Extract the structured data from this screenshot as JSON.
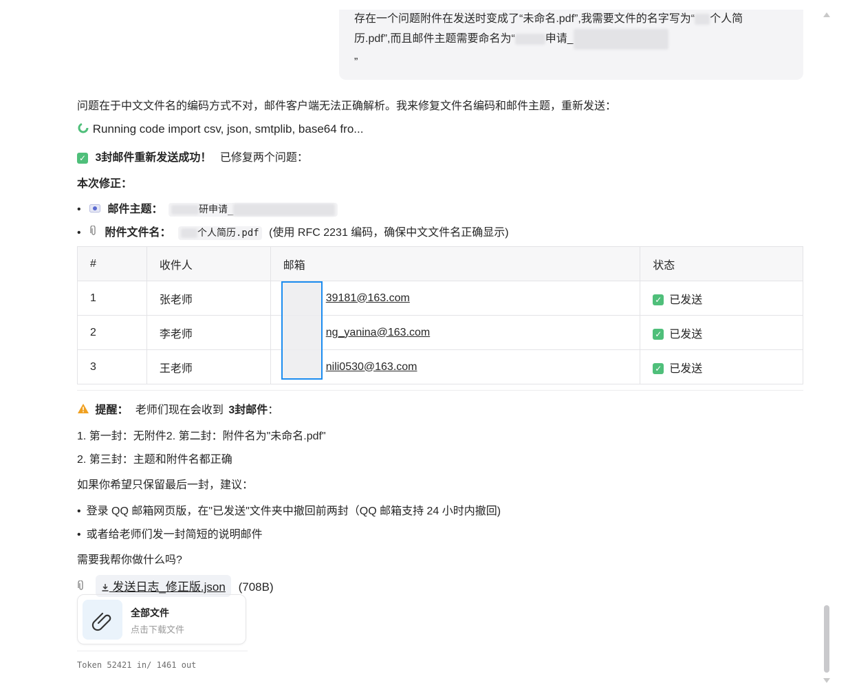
{
  "user_message": {
    "line1_a": "存在一个问题附件在发送时变成了“未命名.pdf”,我需要文件的名字写为“",
    "line1_b": "个人简",
    "line2_a": "历.pdf”,而且邮件主题需要命名为“",
    "line2_b": "申请_",
    "line3": "”"
  },
  "intro": "问题在于中文文件名的编码方式不对，邮件客户端无法正确解析。我来修复文件名编码和邮件主题，重新发送：",
  "running_code": "Running code import csv, json, smtplib, base64 fro...",
  "success": {
    "bold": "3封邮件重新发送成功！",
    "text": "已修复两个问题："
  },
  "fix_heading": "本次修正：",
  "fixes": [
    {
      "icon": "email-icon",
      "label": "邮件主题：",
      "value": "研申请_"
    },
    {
      "icon": "paperclip-icon",
      "label": "附件文件名：",
      "value": "个人简历.pdf",
      "note": "(使用 RFC 2231 编码，确保中文文件名正确显示)"
    }
  ],
  "table": {
    "headers": [
      "#",
      "收件人",
      "邮箱",
      "状态"
    ],
    "rows": [
      {
        "num": "1",
        "name": "张老师",
        "email": "39181@163.com",
        "status": "已发送"
      },
      {
        "num": "2",
        "name": "李老师",
        "email": "ng_yanina@163.com",
        "status": "已发送"
      },
      {
        "num": "3",
        "name": "王老师",
        "email": "nili0530@163.com",
        "status": "已发送"
      }
    ]
  },
  "reminder": {
    "label": "提醒：",
    "text_a": "老师们现在会收到",
    "bold": "3封邮件",
    "text_b": "："
  },
  "ordered": [
    "1. 第一封：无附件2. 第二封：附件名为\"未命名.pdf\"",
    "2. 第三封：主题和附件名都正确"
  ],
  "suggest_heading": "如果你希望只保留最后一封，建议：",
  "suggestions": [
    "登录 QQ 邮箱网页版，在\"已发送\"文件夹中撤回前两封（QQ 邮箱支持 24 小时内撤回)",
    "或者给老师们发一封简短的说明邮件"
  ],
  "question": "需要我帮你做什么吗?",
  "attachment": {
    "name": "发送日志_修正版.json",
    "size": "(708B)"
  },
  "file_card": {
    "title": "全部文件",
    "subtitle": "点击下载文件"
  },
  "token": "Token 52421 in/ 1461 out",
  "colors": {
    "check": "#4fbf7a",
    "highlight": "#1b8cf0",
    "warning": "#f0a020"
  }
}
